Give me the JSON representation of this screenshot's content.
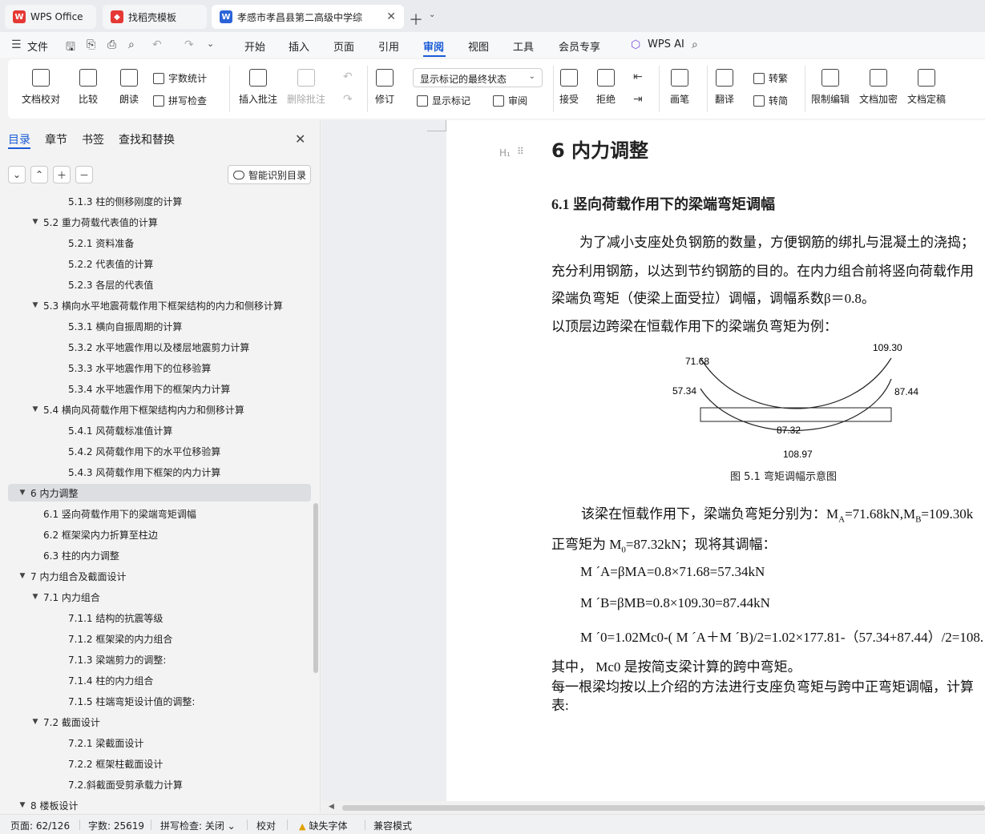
{
  "tabs": [
    {
      "label": "WPS Office",
      "icon": "wps-logo-icon",
      "color": "#e53935"
    },
    {
      "label": "找稻壳模板",
      "icon": "docer-icon",
      "color": "#e53935"
    },
    {
      "label": "孝感市孝昌县第二高级中学综",
      "icon": "word-doc-icon",
      "color": "#2b63d9"
    }
  ],
  "menu": {
    "file": "文件",
    "items": [
      "开始",
      "插入",
      "页面",
      "引用",
      "审阅",
      "视图",
      "工具",
      "会员专享"
    ],
    "active": "审阅",
    "wps_ai": "WPS AI"
  },
  "ribbon": {
    "doc_check": "文档校对",
    "compare": "比较",
    "read_aloud": "朗读",
    "word_count": "字数统计",
    "spell_check": "拼写检查",
    "insert_comment": "插入批注",
    "delete_comment": "删除批注",
    "revision": "修订",
    "markup_select": "显示标记的最终状态",
    "show_markup": "显示标记",
    "review": "审阅",
    "accept": "接受",
    "reject": "拒绝",
    "pen": "画笔",
    "translate": "翻译",
    "to_traditional": "转繁",
    "to_simplified": "转简",
    "restrict_edit": "限制编辑",
    "encrypt": "文档加密",
    "finalize": "文档定稿"
  },
  "nav": {
    "tabs": [
      "目录",
      "章节",
      "书签",
      "查找和替换"
    ],
    "smart_toc": "智能识别目录",
    "toc": [
      {
        "text": "5.1.3 柱的侧移刚度的计算",
        "level": 3,
        "arrow": ""
      },
      {
        "text": "5.2 重力荷载代表值的计算",
        "level": 2,
        "arrow": "▼"
      },
      {
        "text": "5.2.1 资料准备",
        "level": 3,
        "arrow": ""
      },
      {
        "text": "5.2.2 代表值的计算",
        "level": 3,
        "arrow": ""
      },
      {
        "text": "5.2.3 各层的代表值",
        "level": 3,
        "arrow": ""
      },
      {
        "text": "5.3 横向水平地震荷载作用下框架结构的内力和侧移计算",
        "level": 2,
        "arrow": "▼"
      },
      {
        "text": "5.3.1 横向自振周期的计算",
        "level": 3,
        "arrow": ""
      },
      {
        "text": "5.3.2 水平地震作用以及楼层地震剪力计算",
        "level": 3,
        "arrow": ""
      },
      {
        "text": "5.3.3 水平地震作用下的位移验算",
        "level": 3,
        "arrow": ""
      },
      {
        "text": "5.3.4 水平地震作用下的框架内力计算",
        "level": 3,
        "arrow": ""
      },
      {
        "text": "5.4 横向风荷载作用下框架结构内力和侧移计算",
        "level": 2,
        "arrow": "▼"
      },
      {
        "text": "5.4.1 风荷载标准值计算",
        "level": 3,
        "arrow": ""
      },
      {
        "text": "5.4.2 风荷载作用下的水平位移验算",
        "level": 3,
        "arrow": ""
      },
      {
        "text": "5.4.3 风荷载作用下框架的内力计算",
        "level": 3,
        "arrow": ""
      },
      {
        "text": "6  内力调整",
        "level": 1,
        "arrow": "▼",
        "selected": true
      },
      {
        "text": "6.1 竖向荷载作用下的梁端弯矩调幅",
        "level": 2,
        "arrow": ""
      },
      {
        "text": "6.2 框架梁内力折算至柱边",
        "level": 2,
        "arrow": ""
      },
      {
        "text": "6.3 柱的内力调整",
        "level": 2,
        "arrow": ""
      },
      {
        "text": "7  内力组合及截面设计",
        "level": 1,
        "arrow": "▼"
      },
      {
        "text": "7.1 内力组合",
        "level": 2,
        "arrow": "▼"
      },
      {
        "text": "7.1.1 结构的抗震等级",
        "level": 3,
        "arrow": ""
      },
      {
        "text": "7.1.2 框架梁的内力组合",
        "level": 3,
        "arrow": ""
      },
      {
        "text": "7.1.3 梁端剪力的调整:",
        "level": 3,
        "arrow": ""
      },
      {
        "text": "7.1.4 柱的内力组合",
        "level": 3,
        "arrow": ""
      },
      {
        "text": "7.1.5 柱端弯矩设计值的调整:",
        "level": 3,
        "arrow": ""
      },
      {
        "text": "7.2 截面设计",
        "level": 2,
        "arrow": "▼"
      },
      {
        "text": "7.2.1 梁截面设计",
        "level": 3,
        "arrow": ""
      },
      {
        "text": "7.2.2 框架柱截面设计",
        "level": 3,
        "arrow": ""
      },
      {
        "text": "7.2.斜截面受剪承载力计算",
        "level": 3,
        "arrow": ""
      },
      {
        "text": "8  楼板设计",
        "level": 1,
        "arrow": "▼"
      }
    ]
  },
  "doc": {
    "h1": "6  内力调整",
    "h2": "6.1 竖向荷载作用下的梁端弯矩调幅",
    "p1": "为了减小支座处负钢筋的数量，方便钢筋的绑扎与混凝土的浇捣；",
    "p2": "充分利用钢筋，以达到节约钢筋的目的。在内力组合前将竖向荷载作用",
    "p3": "梁端负弯矩（使梁上面受拉）调幅，调幅系数β＝0.8。",
    "p4": "以顶层边跨梁在恒载作用下的梁端负弯矩为例：",
    "figure": {
      "labels": [
        "71.68",
        "57.34",
        "109.30",
        "87.44",
        "87.32",
        "108.97"
      ],
      "caption": "图 5.1   弯矩调幅示意图"
    },
    "p5": "该梁在恒载作用下，梁端负弯矩分别为：M",
    "p5_sub_a": "A",
    "p5_mid": "=71.68kN,M",
    "p5_sub_b": "B",
    "p5_end": "=109.30k",
    "p6": "正弯矩为 M",
    "p6_sub": "0",
    "p6_end": "=87.32kN；现将其调幅：",
    "eq1": "M ´A=βMA=0.8×71.68=57.34kN",
    "eq2": "M ´B=βMB=0.8×109.30=87.44kN",
    "eq3": "M ´0=1.02Mc0-( M ´A＋M ´B)/2=1.02×177.81-（57.34+87.44）/2=108.",
    "p7": "其中，  Mc0 是按简支梁计算的跨中弯矩。",
    "p8": "每一根梁均按以上介绍的方法进行支座负弯矩与跨中正弯矩调幅，计算",
    "p9": "表:"
  },
  "status": {
    "page": "页面: 62/126",
    "words": "字数: 25619",
    "spell": "拼写检查: 关闭",
    "proof": "校对",
    "missing_font": "缺失字体",
    "compat": "兼容模式"
  }
}
